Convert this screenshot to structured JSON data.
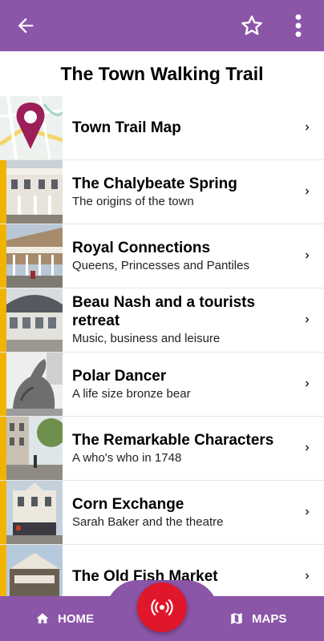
{
  "app_bar": {
    "back_icon": "arrow-back-icon",
    "favorite_icon": "star-outline-icon",
    "more_icon": "more-vert-icon",
    "color": "#8b55a8"
  },
  "page": {
    "title": "The Town Walking Trail"
  },
  "list": {
    "accent_color": "#f0b400",
    "items": [
      {
        "title": "Town Trail Map",
        "subtitle": ""
      },
      {
        "title": "The Chalybeate Spring",
        "subtitle": "The origins of the town"
      },
      {
        "title": "Royal Connections",
        "subtitle": "Queens, Princesses and Pantiles"
      },
      {
        "title": "Beau Nash and a tourists retreat",
        "subtitle": "Music, business and leisure"
      },
      {
        "title": "Polar Dancer",
        "subtitle": "A life size bronze bear"
      },
      {
        "title": "The Remarkable Characters",
        "subtitle": "A who's who in 1748"
      },
      {
        "title": "Corn Exchange",
        "subtitle": "Sarah Baker and the theatre"
      },
      {
        "title": "The Old Fish Market",
        "subtitle": ""
      }
    ]
  },
  "bottom_nav": {
    "home_label": "HOME",
    "maps_label": "MAPS",
    "fab_icon": "broadcast-icon",
    "fab_color": "#e0162b"
  }
}
